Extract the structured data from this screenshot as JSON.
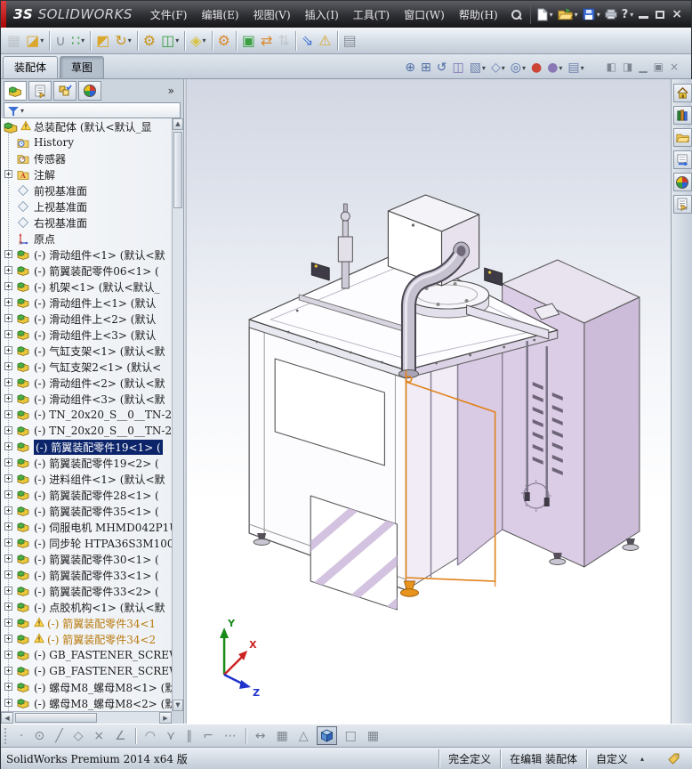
{
  "window": {
    "logo_mark": "ЗS",
    "logo_text": "SOLIDWORKS",
    "accent_red": "#b00606",
    "minimize": "minimize",
    "maximize": "maximize",
    "close": "close"
  },
  "menubar": {
    "items": [
      {
        "name": "menu-file",
        "label": "文件(F)"
      },
      {
        "name": "menu-edit",
        "label": "编辑(E)"
      },
      {
        "name": "menu-view",
        "label": "视图(V)"
      },
      {
        "name": "menu-insert",
        "label": "插入(I)"
      },
      {
        "name": "menu-tools",
        "label": "工具(T)"
      },
      {
        "name": "menu-window",
        "label": "窗口(W)"
      },
      {
        "name": "menu-help",
        "label": "帮助(H)"
      }
    ]
  },
  "assembly_toolbar": {
    "buttons": [
      {
        "name": "insert-component-icon",
        "glyph": "▦",
        "color": "#9aa0a8",
        "state": "disabled"
      },
      {
        "name": "open-part-icon",
        "glyph": "◪",
        "color": "#d9a62e",
        "caret": true
      },
      {
        "name": "mate-icon",
        "glyph": "∪",
        "color": "#8a909a",
        "sep": true
      },
      {
        "name": "linear-pattern-icon",
        "glyph": "∷",
        "color": "#3ba042",
        "caret": true
      },
      {
        "name": "smart-fasteners-icon",
        "glyph": "◩",
        "color": "#d9a62e",
        "sep": true
      },
      {
        "name": "rotate-component-icon",
        "glyph": "↻",
        "color": "#c9941a",
        "caret": true
      },
      {
        "name": "move-component-icon",
        "glyph": "⚙",
        "color": "#c9941a",
        "sep": true
      },
      {
        "name": "show-hidden-components-icon",
        "glyph": "◫",
        "color": "#3ba042",
        "caret": true
      },
      {
        "name": "appearance-wand-icon",
        "glyph": "◈",
        "color": "#d9c23f",
        "caret": true,
        "sep": true
      },
      {
        "name": "assembly-settings-gears-icon",
        "glyph": "⚙",
        "color": "#d98a2e",
        "sep": true
      },
      {
        "name": "smart-components-icon",
        "glyph": "▣",
        "color": "#3ba042",
        "sep": true
      },
      {
        "name": "move-with-triad-icon",
        "glyph": "⇄",
        "color": "#d98a2e"
      },
      {
        "name": "rotate-with-triad-icon",
        "glyph": "⇅",
        "color": "#9aa0a8",
        "state": "disabled"
      },
      {
        "name": "exploded-view-icon",
        "glyph": "⇘",
        "color": "#3f6fd9",
        "sep": true
      },
      {
        "name": "interference-detection-icon",
        "glyph": "⚠",
        "color": "#d9a62e"
      },
      {
        "name": "assembly-visualization-icon",
        "glyph": "▤",
        "color": "#8a909a",
        "sep": true
      }
    ]
  },
  "cmd_tabs": {
    "tabs": [
      {
        "name": "tab-assembly",
        "label": "装配体",
        "cls": "active"
      },
      {
        "name": "tab-sketch",
        "label": "草图",
        "cls": "pressed"
      }
    ]
  },
  "viewport_toolbar": {
    "buttons": [
      {
        "name": "zoom-to-fit-icon",
        "glyph": "⊕",
        "color": "#4f6fa5"
      },
      {
        "name": "zoom-to-area-icon",
        "glyph": "⊞",
        "color": "#4f6fa5"
      },
      {
        "name": "previous-view-icon",
        "glyph": "↺",
        "color": "#4f6fa5"
      },
      {
        "name": "section-view-icon",
        "glyph": "◫",
        "color": "#7a6fb0"
      },
      {
        "name": "view-orientation-icon",
        "glyph": "▧",
        "color": "#6f82ad",
        "caret": true
      },
      {
        "name": "display-style-icon",
        "glyph": "◇",
        "color": "#6f82ad",
        "caret": true
      },
      {
        "name": "hide-show-items-icon",
        "glyph": "◎",
        "color": "#4f6fa5",
        "caret": true
      },
      {
        "name": "edit-appearance-icon",
        "glyph": "●",
        "color": "#cc4433"
      },
      {
        "name": "apply-scene-icon",
        "glyph": "●",
        "color": "#8a77b5",
        "caret": true
      },
      {
        "name": "view-settings-icon",
        "glyph": "▤",
        "color": "#6f82ad",
        "caret": true
      }
    ]
  },
  "doc_buttons": {
    "buttons": [
      {
        "name": "collapse-panel-left-icon",
        "glyph": "◧"
      },
      {
        "name": "collapse-panel-right-icon",
        "glyph": "◨"
      },
      {
        "name": "doc-minimize-icon",
        "glyph": "▁"
      },
      {
        "name": "doc-restore-icon",
        "glyph": "▣"
      },
      {
        "name": "doc-close-icon",
        "glyph": "×"
      }
    ]
  },
  "feature_panel": {
    "chevron": "»",
    "tree": [
      {
        "name": "tree-root",
        "icon": "root",
        "state": "rootrow",
        "warn": true,
        "label": "总装配体 (默认<默认_显"
      },
      {
        "name": "tree-item-history",
        "icon": "fhist",
        "label": "History"
      },
      {
        "name": "tree-item-sensors",
        "icon": "fsens",
        "label": "传感器"
      },
      {
        "name": "tree-item-annotations",
        "icon": "fnote",
        "expand": true,
        "label": "注解"
      },
      {
        "name": "tree-item-front-plane",
        "icon": "plane",
        "label": "前视基准面"
      },
      {
        "name": "tree-item-top-plane",
        "icon": "plane",
        "label": "上视基准面"
      },
      {
        "name": "tree-item-right-plane",
        "icon": "plane",
        "label": "右视基准面"
      },
      {
        "name": "tree-item-origin",
        "icon": "origin",
        "label": "原点"
      },
      {
        "name": "tree-item",
        "icon": "asm",
        "expand": true,
        "label": "(-) 滑动组件<1> (默认<默"
      },
      {
        "name": "tree-item",
        "icon": "asm",
        "expand": true,
        "label": "(-) 箭翼装配零件06<1> ("
      },
      {
        "name": "tree-item",
        "icon": "asm",
        "expand": true,
        "label": "(-) 机架<1> (默认<默认_"
      },
      {
        "name": "tree-item",
        "icon": "asm",
        "expand": true,
        "label": "(-) 滑动组件上<1> (默认"
      },
      {
        "name": "tree-item",
        "icon": "asm",
        "expand": true,
        "label": "(-) 滑动组件上<2> (默认"
      },
      {
        "name": "tree-item",
        "icon": "asm",
        "expand": true,
        "label": "(-) 滑动组件上<3> (默认"
      },
      {
        "name": "tree-item",
        "icon": "asm",
        "expand": true,
        "label": "(-) 气缸支架<1> (默认<默"
      },
      {
        "name": "tree-item",
        "icon": "asm",
        "expand": true,
        "label": "(-) 气缸支架2<1> (默认<"
      },
      {
        "name": "tree-item",
        "icon": "asm",
        "expand": true,
        "label": "(-) 滑动组件<2> (默认<默"
      },
      {
        "name": "tree-item",
        "icon": "asm",
        "expand": true,
        "label": "(-) 滑动组件<3> (默认<默"
      },
      {
        "name": "tree-item",
        "icon": "asm",
        "expand": true,
        "label": "(-) TN_20x20_S__0__TN-2"
      },
      {
        "name": "tree-item",
        "icon": "asm",
        "expand": true,
        "label": "(-) TN_20x20_S__0__TN-2"
      },
      {
        "name": "tree-item-selected",
        "icon": "asm",
        "expand": true,
        "state": "selected",
        "label": "(-) 箭翼装配零件19<1> ("
      },
      {
        "name": "tree-item",
        "icon": "asm",
        "expand": true,
        "label": "(-) 箭翼装配零件19<2> ("
      },
      {
        "name": "tree-item",
        "icon": "asm",
        "expand": true,
        "label": "(-) 进料组件<1> (默认<默"
      },
      {
        "name": "tree-item",
        "icon": "asm",
        "expand": true,
        "label": "(-) 箭翼装配零件28<1> ("
      },
      {
        "name": "tree-item",
        "icon": "asm",
        "expand": true,
        "label": "(-) 箭翼装配零件35<1> ("
      },
      {
        "name": "tree-item",
        "icon": "asm",
        "expand": true,
        "label": "(-) 伺服电机 MHMD042P1U"
      },
      {
        "name": "tree-item",
        "icon": "asm",
        "expand": true,
        "label": "(-) 同步轮 HTPA36S3M100"
      },
      {
        "name": "tree-item",
        "icon": "asm",
        "expand": true,
        "label": "(-) 箭翼装配零件30<1> ("
      },
      {
        "name": "tree-item",
        "icon": "asm",
        "expand": true,
        "label": "(-) 箭翼装配零件33<1> ("
      },
      {
        "name": "tree-item",
        "icon": "asm",
        "expand": true,
        "label": "(-) 箭翼装配零件33<2> ("
      },
      {
        "name": "tree-item",
        "icon": "asm",
        "expand": true,
        "label": "(-) 点胶机构<1> (默认<默"
      },
      {
        "name": "tree-item-warning",
        "icon": "asm",
        "expand": true,
        "warn": true,
        "state": "warntext",
        "label": "(-) 箭翼装配零件34<1"
      },
      {
        "name": "tree-item-warning",
        "icon": "asm",
        "expand": true,
        "warn": true,
        "state": "warntext",
        "label": "(-) 箭翼装配零件34<2"
      },
      {
        "name": "tree-item",
        "icon": "asm",
        "expand": true,
        "label": "(-) GB_FASTENER_SCREWS_"
      },
      {
        "name": "tree-item",
        "icon": "asm",
        "expand": true,
        "label": "(-) GB_FASTENER_SCREWS_"
      },
      {
        "name": "tree-item",
        "icon": "asm",
        "expand": true,
        "label": "(-) 螺母M8_螺母M8<1> (默"
      },
      {
        "name": "tree-item",
        "icon": "asm",
        "expand": true,
        "label": "(-) 螺母M8_螺母M8<2> (默"
      }
    ]
  },
  "sketch_toolbar": {
    "buttons": [
      {
        "name": "sketch-point-icon",
        "glyph": "·"
      },
      {
        "name": "sketch-circle-icon",
        "glyph": "⊙"
      },
      {
        "name": "sketch-line-icon",
        "glyph": "╱"
      },
      {
        "name": "sketch-polygon-icon",
        "glyph": "◇"
      },
      {
        "name": "sketch-trim-icon",
        "glyph": "×"
      },
      {
        "name": "sketch-angle-icon",
        "glyph": "∠"
      },
      {
        "name": "separator",
        "sep": true
      },
      {
        "name": "sketch-arc-icon",
        "glyph": "◠"
      },
      {
        "name": "sketch-spline-icon",
        "glyph": "⋎"
      },
      {
        "name": "sketch-parallel-icon",
        "glyph": "∥"
      },
      {
        "name": "sketch-corner-icon",
        "glyph": "⌐"
      },
      {
        "name": "sketch-construction-icon",
        "glyph": "⋯"
      },
      {
        "name": "separator",
        "sep": true
      },
      {
        "name": "dimension-icon",
        "glyph": "↔"
      },
      {
        "name": "grid-icon",
        "glyph": "▦"
      },
      {
        "name": "measure-icon",
        "glyph": "△"
      },
      {
        "name": "shaded-cube-view-button",
        "cube": true
      },
      {
        "name": "wireframe-view-icon",
        "glyph": "□"
      },
      {
        "name": "table-view-icon",
        "glyph": "▦"
      }
    ]
  },
  "statusbar": {
    "left": "SolidWorks Premium 2014 x64 版",
    "cells": [
      {
        "name": "status-fully-defined",
        "label": "完全定义"
      },
      {
        "name": "status-editing",
        "label": "在编辑 装配体"
      },
      {
        "name": "status-custom",
        "label": "自定义",
        "caret": true
      }
    ]
  },
  "triad": {
    "x": "X",
    "y": "Y",
    "z": "Z"
  },
  "model_colors": {
    "selection_highlight": "#e0821a",
    "panel_lavender": "#dccde6",
    "panel_white": "#fcfcfe"
  }
}
